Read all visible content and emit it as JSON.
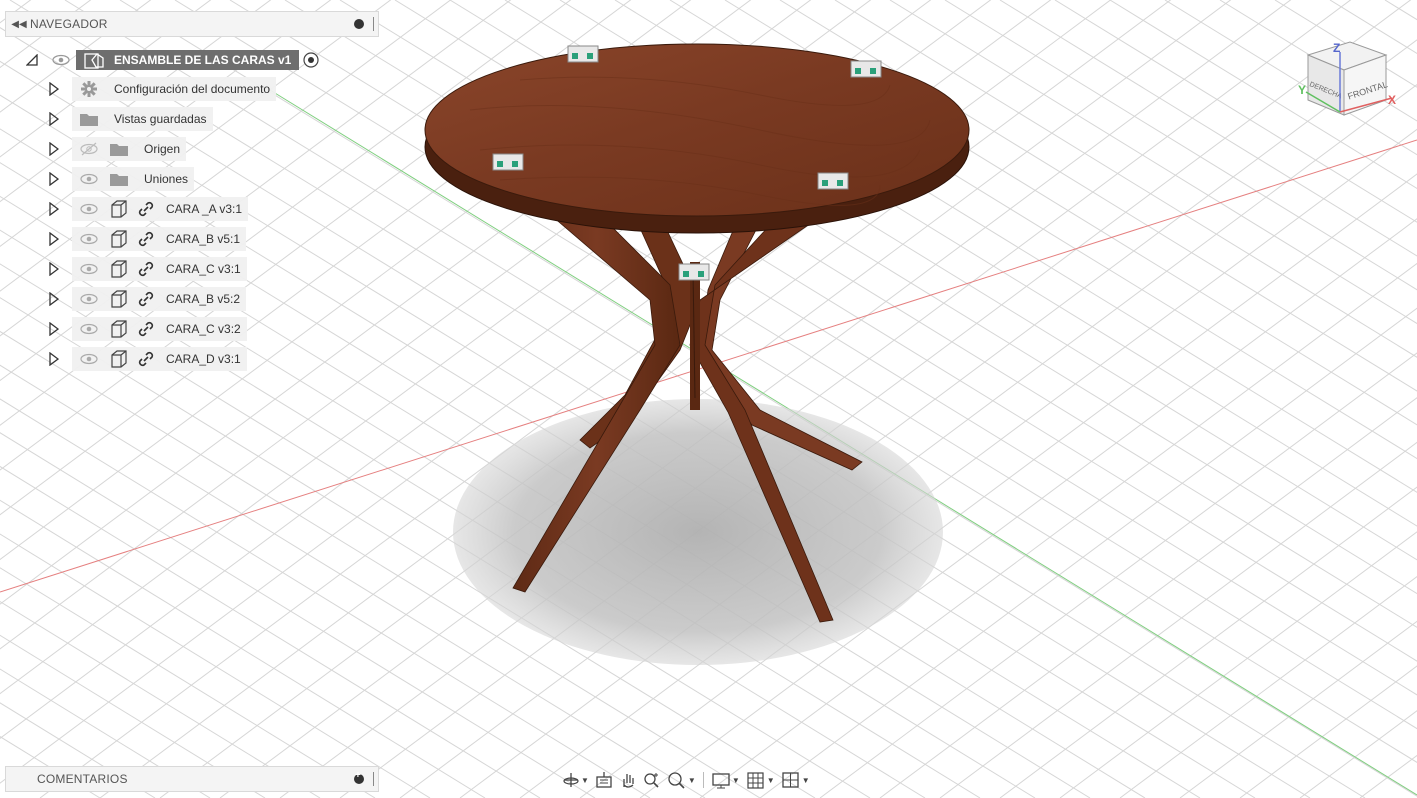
{
  "navigator": {
    "title": "NAVEGADOR",
    "root": {
      "label": "ENSAMBLE DE LAS CARAS v1"
    },
    "items": [
      {
        "label": "Configuración del documento",
        "icon": "gear-icon"
      },
      {
        "label": "Vistas guardadas",
        "icon": "folder-icon"
      },
      {
        "label": "Origen",
        "icon": "folder-icon",
        "visibility": "hidden"
      },
      {
        "label": "Uniones",
        "icon": "folder-icon",
        "visibility": "visible"
      },
      {
        "label": "CARA _A v3:1",
        "icon": "component-icon"
      },
      {
        "label": "CARA_B v5:1",
        "icon": "component-icon"
      },
      {
        "label": "CARA_C v3:1",
        "icon": "component-icon"
      },
      {
        "label": "CARA_B v5:2",
        "icon": "component-icon"
      },
      {
        "label": "CARA_C v3:2",
        "icon": "component-icon"
      },
      {
        "label": "CARA_D v3:1",
        "icon": "component-icon"
      }
    ]
  },
  "comments": {
    "title": "COMENTARIOS"
  },
  "viewcube": {
    "front_label": "FRONTAL",
    "right_label": "DERECHA",
    "axis_x": "X",
    "axis_y": "Y",
    "axis_z": "Z"
  },
  "toolbar": {
    "buttons": [
      "orbit-icon",
      "look-at-icon",
      "pan-icon",
      "zoom-icon",
      "fit-icon",
      "display-settings-icon",
      "grid-settings-icon",
      "viewports-icon"
    ]
  },
  "colors": {
    "wood": "#7a3a22",
    "wood_light": "#8e4a2c",
    "grid": "#d4d4d4",
    "axis_red": "#e06060",
    "axis_green": "#60c060",
    "root_bg": "#6e6e6e",
    "shadow": "#bdbdbd"
  }
}
